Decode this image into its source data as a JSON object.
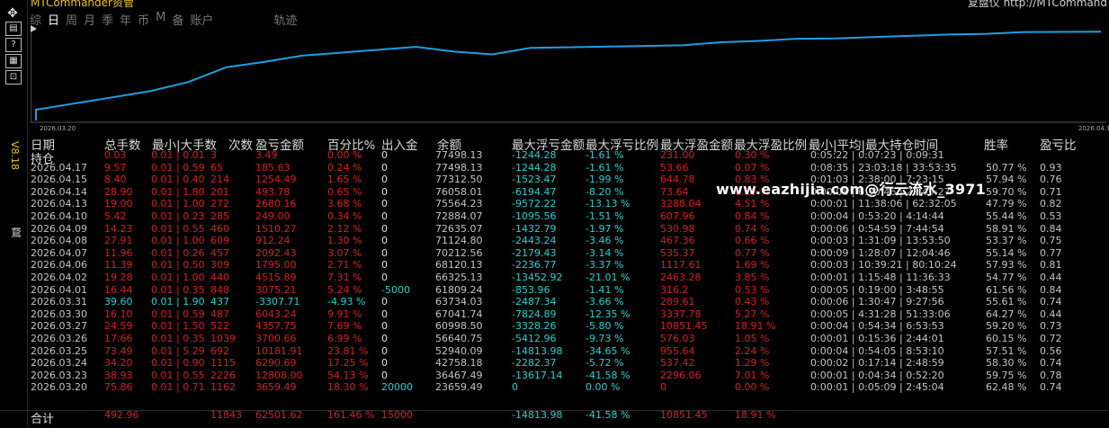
{
  "app": {
    "title": "MTCommander资管",
    "top_right": "复盘仪 http://MTCommand",
    "version": "V8.18"
  },
  "tools": [
    {
      "name": "move-icon",
      "glyph": "✥"
    },
    {
      "name": "tool-1-icon",
      "glyph": "▤"
    },
    {
      "name": "help-icon",
      "glyph": "?"
    },
    {
      "name": "tool-3-icon",
      "glyph": "▦"
    },
    {
      "name": "tool-4-icon",
      "glyph": "⊡"
    }
  ],
  "side_mark": "鵞",
  "tabs": [
    {
      "label": "综",
      "active": false
    },
    {
      "label": "日",
      "active": true
    },
    {
      "label": "周",
      "active": false
    },
    {
      "label": "月",
      "active": false
    },
    {
      "label": "季",
      "active": false
    },
    {
      "label": "年",
      "active": false
    },
    {
      "label": "币",
      "active": false
    },
    {
      "label": "M",
      "active": false
    },
    {
      "label": "备",
      "active": false
    },
    {
      "label": "账户",
      "active": false
    },
    {
      "label": "轨迹",
      "active": false
    }
  ],
  "chart_data": {
    "type": "line",
    "x": [
      "2026.03.20",
      "2026.03.23",
      "2026.03.24",
      "2026.03.25",
      "2026.03.26",
      "2026.03.27",
      "2026.03.30",
      "2026.03.31",
      "2026.04.01",
      "2026.04.02",
      "2026.04.06",
      "2026.04.07",
      "2026.04.08",
      "2026.04.09",
      "2026.04.10",
      "2026.04.13",
      "2026.04.14",
      "2026.04.15",
      "2026.04.17"
    ],
    "series": [
      {
        "values": [
          23659.49,
          36467.49,
          42758.18,
          52940.09,
          56640.75,
          60998.5,
          67041.74,
          63734.03,
          61809.24,
          66325.13,
          68120.13,
          70212.56,
          71124.8,
          72635.07,
          72884.07,
          75564.23,
          76058.01,
          77312.5,
          77498.13
        ]
      }
    ],
    "x_start_label": "2026.03.20",
    "x_end_label": "2026.04.17",
    "line_color": "#1e9fe0"
  },
  "table": {
    "headers": [
      "日期",
      "总手数",
      "最小|大手数",
      "次数",
      "盈亏金额",
      "百分比%",
      "出入金",
      "余额",
      "最大浮亏金额",
      "最大浮亏比例",
      "最大浮盈金额",
      "最大浮盈比例",
      "最小|平均|最大持仓时间",
      "胜率",
      "盈亏比"
    ],
    "rows": [
      [
        "持仓",
        "0.03",
        "0.01 | 0.01",
        "3",
        "3.49",
        "0.00 %",
        "0",
        "77498.13",
        "-1244.28",
        "-1.61 %",
        "231.00",
        "0.30 %",
        "0:05:22 | 0:07:23 | 0:09:31",
        "",
        ""
      ],
      [
        "2026.04.17",
        "9.57",
        "0.01 | 0.59",
        "65",
        "185.63",
        "0.24 %",
        "0",
        "77498.13",
        "-1244.28",
        "-1.61 %",
        "53.66",
        "0.07 %",
        "0:08:35 | 23:03:18 | 33:53:35",
        "50.77 %",
        "0.93"
      ],
      [
        "2026.04.15",
        "8.40",
        "0.01 | 0.40",
        "214",
        "1254.49",
        "1.65 %",
        "0",
        "77312.50",
        "-1523.47",
        "-1.99 %",
        "644.78",
        "0.83 %",
        "0:01:03 | 2:38:00 | 7:23:15",
        "57.94 %",
        "0.76"
      ],
      [
        "2026.04.14",
        "28.90",
        "0.01 | 1.80",
        "201",
        "493.78",
        "0.65 %",
        "0",
        "76058.01",
        "-6194.47",
        "-8.20 %",
        "73.64",
        "0.10 %",
        "0:00:08 | 6:30:46 | 22:49:27",
        "59.70 %",
        "0.71"
      ],
      [
        "2026.04.13",
        "19.00",
        "0.01 | 1.00",
        "272",
        "2680.16",
        "3.68 %",
        "0",
        "75564.23",
        "-9572.22",
        "-13.13 %",
        "3288.04",
        "4.51 %",
        "0:00:01 | 11:38:06 | 62:32:05",
        "47.79 %",
        "0.82"
      ],
      [
        "2026.04.10",
        "5.42",
        "0.01 | 0.23",
        "285",
        "249.00",
        "0.34 %",
        "0",
        "72884.07",
        "-1095.56",
        "-1.51 %",
        "607.96",
        "0.84 %",
        "0:00:04 | 0:53:20 | 4:14:44",
        "55.44 %",
        "0.53"
      ],
      [
        "2026.04.09",
        "14.23",
        "0.01 | 0.55",
        "460",
        "1510.27",
        "2.12 %",
        "0",
        "72635.07",
        "-1432.79",
        "-1.97 %",
        "530.98",
        "0.74 %",
        "0:00:06 | 0:54:59 | 7:44:54",
        "58.91 %",
        "0.84"
      ],
      [
        "2026.04.08",
        "27.91",
        "0.01 | 1.00",
        "609",
        "912.24",
        "1.30 %",
        "0",
        "71124.80",
        "-2443.24",
        "-3.46 %",
        "467.36",
        "0.66 %",
        "0:00:03 | 1:31:09 | 13:53:50",
        "53.37 %",
        "0.75"
      ],
      [
        "2026.04.07",
        "11.96",
        "0.01 | 0.26",
        "457",
        "2092.43",
        "3.07 %",
        "0",
        "70212.56",
        "-2179.43",
        "-3.14 %",
        "535.37",
        "0.77 %",
        "0:00:09 | 1:28:07 | 12:04:46",
        "55.14 %",
        "0.77"
      ],
      [
        "2026.04.06",
        "11.39",
        "0.01 | 0.50",
        "309",
        "1795.00",
        "2.71 %",
        "0",
        "68120.13",
        "-2236.77",
        "-3.37 %",
        "1117.61",
        "1.69 %",
        "0:00:03 | 10:39:21 | 80:10:24",
        "57.93 %",
        "0.81"
      ],
      [
        "2026.04.02",
        "19.28",
        "0.01 | 1.00",
        "440",
        "4515.89",
        "7.31 %",
        "0",
        "66325.13",
        "-13452.92",
        "-21.01 %",
        "2463.28",
        "3.85 %",
        "0:00:01 | 1:15:48 | 11:36:33",
        "54.77 %",
        "0.44"
      ],
      [
        "2026.04.01",
        "16.44",
        "0.01 | 0.35",
        "848",
        "3075.21",
        "5.24 %",
        "-5000",
        "61809.24",
        "-853.96",
        "-1.41 %",
        "316.2",
        "0.53 %",
        "0:00:05 | 0:19:00 | 3:48:55",
        "61.56 %",
        "0.84"
      ],
      [
        "2026.03.31",
        "39.60",
        "0.01 | 1.90",
        "437",
        "-3307.71",
        "-4.93 %",
        "0",
        "63734.03",
        "-2487.34",
        "-3.66 %",
        "289.61",
        "0.43 %",
        "0:00:06 | 1:30:47 | 9:27:56",
        "55.61 %",
        "0.74"
      ],
      [
        "2026.03.30",
        "16.10",
        "0.01 | 0.59",
        "487",
        "6043.24",
        "9.91 %",
        "0",
        "67041.74",
        "-7824.89",
        "-12.35 %",
        "3337.78",
        "5.27 %",
        "0:00:05 | 4:31:28 | 51:33:06",
        "64.27 %",
        "0.44"
      ],
      [
        "2026.03.27",
        "24.59",
        "0.01 | 1.50",
        "522",
        "4357.75",
        "7.69 %",
        "0",
        "60998.50",
        "-3328.26",
        "-5.80 %",
        "10851.45",
        "18.91 %",
        "0:00:04 | 0:54:34 | 6:53:53",
        "59.20 %",
        "0.73"
      ],
      [
        "2026.03.26",
        "17.66",
        "0.01 | 0.35",
        "1039",
        "3700.66",
        "6.99 %",
        "0",
        "56640.75",
        "-5412.96",
        "-9.73 %",
        "576.03",
        "1.05 %",
        "0:00:01 | 0:15:36 | 2:44:01",
        "60.15 %",
        "0.72"
      ],
      [
        "2026.03.25",
        "73.49",
        "0.01 | 5.29",
        "692",
        "10181.91",
        "23.81 %",
        "0",
        "52940.09",
        "-14813.98",
        "-34.65 %",
        "955.64",
        "2.24 %",
        "0:00:04 | 0:54:05 | 8:53:10",
        "57.51 %",
        "0.56"
      ],
      [
        "2026.03.24",
        "34.20",
        "0.01 | 0.90",
        "1115",
        "6290.69",
        "17.25 %",
        "0",
        "42758.18",
        "-2282.37",
        "-5.72 %",
        "537.42",
        "1.29 %",
        "0:00:02 | 0:17:14 | 2:48:59",
        "58.30 %",
        "0.74"
      ],
      [
        "2026.03.23",
        "38.93",
        "0.01 | 0.55",
        "2226",
        "12808.00",
        "54.13 %",
        "0",
        "36467.49",
        "-13617.14",
        "-41.58 %",
        "2296.06",
        "7.01 %",
        "0:00:01 | 0:04:34 | 0:52:20",
        "59.75 %",
        "0.78"
      ],
      [
        "2026.03.20",
        "75.86",
        "0.01 | 0.71",
        "1162",
        "3659.49",
        "18.30 %",
        "20000",
        "23659.49",
        "0",
        "0.00 %",
        "0",
        "0.00 %",
        "0:00:01 | 0:05:09 | 2:45:04",
        "62.48 %",
        "0.74"
      ]
    ],
    "total": [
      "合计",
      "492.96",
      "",
      "11843",
      "62501.62",
      "161.46 %",
      "15000",
      "",
      "-14813.98",
      "-41.58 %",
      "10851.45",
      "18.91 %",
      "",
      "",
      ""
    ]
  },
  "watermark": "www.eazhijia.com@行云流水_3971"
}
